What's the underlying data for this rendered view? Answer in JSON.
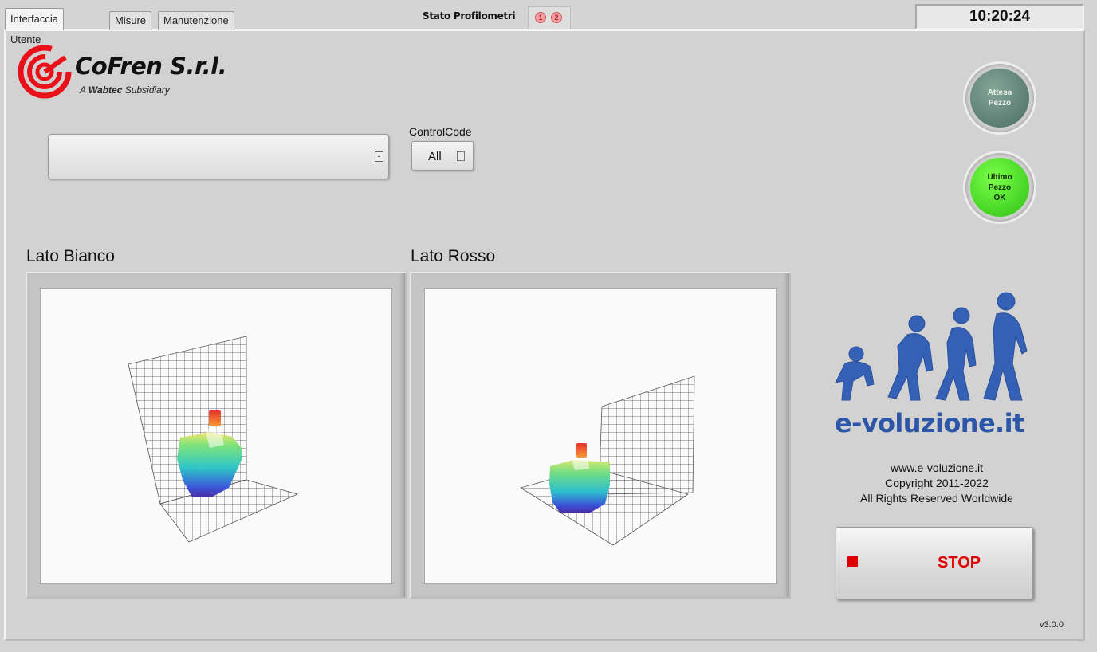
{
  "tabs": [
    {
      "label": "Interfaccia Utente",
      "active": true
    },
    {
      "label": "Misure",
      "active": false
    },
    {
      "label": "Manutenzione",
      "active": false
    }
  ],
  "stato": {
    "label": "Stato Profilometri",
    "leds": [
      "1",
      "2"
    ]
  },
  "clock": {
    "time": "10:20:24"
  },
  "logo": {
    "title": "CoFren S.r.l.",
    "sub_prefix": "A",
    "sub_brand": "Wabtec",
    "sub_suffix": "Subsidiary"
  },
  "selector": {
    "value": ""
  },
  "control_code": {
    "label": "ControlCode",
    "value": "All"
  },
  "indicators": {
    "wait": {
      "label": "Attesa\nPezzo"
    },
    "ok": {
      "label": "Ultimo\nPezzo\nOK"
    }
  },
  "views": {
    "left": {
      "label": "Lato Bianco"
    },
    "right": {
      "label": "Lato Rosso"
    }
  },
  "evolution": {
    "text": "e-voluzione.it",
    "site": "www.e-voluzione.it",
    "copyright": "Copyright 2011-2022",
    "rights": "All Rights Reserved Worldwide"
  },
  "stop": {
    "label": "STOP"
  },
  "version": "v3.0.0",
  "colors": {
    "stop_red": "#e00000",
    "ok_green": "#2cc013",
    "evo_blue": "#2c56a8"
  }
}
